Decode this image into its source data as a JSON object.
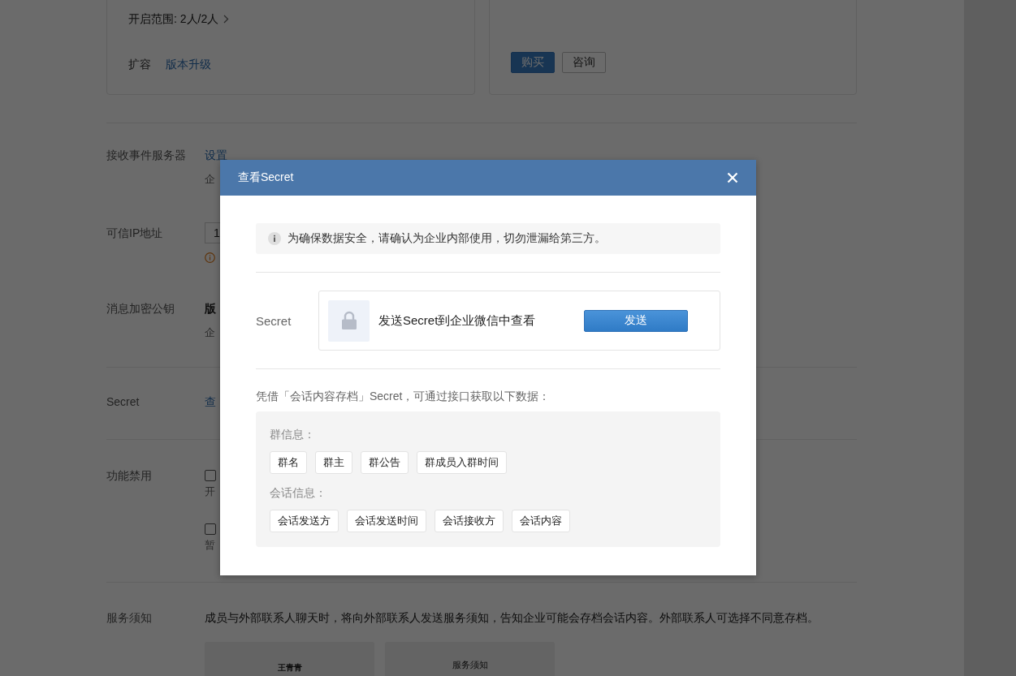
{
  "background_page": {
    "plan_cards": [
      {
        "kind": "info",
        "line": "开启范围: 2人/2人",
        "links": [
          "扩容",
          "版本升级"
        ]
      },
      {
        "kind": "purchase",
        "buttons": [
          {
            "label": "购买",
            "primary": true
          },
          {
            "label": "咨询",
            "primary": false
          }
        ]
      }
    ],
    "settings": [
      {
        "kind": "link",
        "label": "接收事件服务器",
        "value": "设置",
        "note": "企"
      },
      {
        "kind": "input",
        "label": "可信IP地址",
        "value": "1"
      },
      {
        "kind": "text",
        "label": "消息加密公钥",
        "value": "版",
        "note": "企"
      },
      {
        "kind": "link",
        "label": "Secret",
        "value": "查"
      },
      {
        "kind": "checkboxes",
        "label": "功能禁用",
        "options": [
          {
            "checked": false,
            "note": "开"
          },
          {
            "checked": false,
            "note": "暂"
          }
        ]
      },
      {
        "kind": "notice",
        "label": "服务须知",
        "text": "成员与外部联系人聊天时，将向外部联系人发送服务须知，告知企业可能会存档会话内容。外部联系人可选择不同意存档。",
        "previews": [
          "王青青",
          "服务须知"
        ]
      }
    ]
  },
  "dialog": {
    "title": "查看Secret",
    "notice": "为确保数据安全，请确认为企业内部使用，切勿泄漏给第三方。",
    "secret_label": "Secret",
    "secret_prompt": "发送Secret到企业微信中查看",
    "send_button": "发送",
    "description": "凭借「会话内容存档」Secret，可通过接口获取以下数据：",
    "groups": [
      {
        "title": "群信息：",
        "tags": [
          "群名",
          "群主",
          "群公告",
          "群成员入群时间"
        ]
      },
      {
        "title": "会话信息：",
        "tags": [
          "会话发送方",
          "会话发送时间",
          "会话接收方",
          "会话内容"
        ]
      }
    ]
  }
}
